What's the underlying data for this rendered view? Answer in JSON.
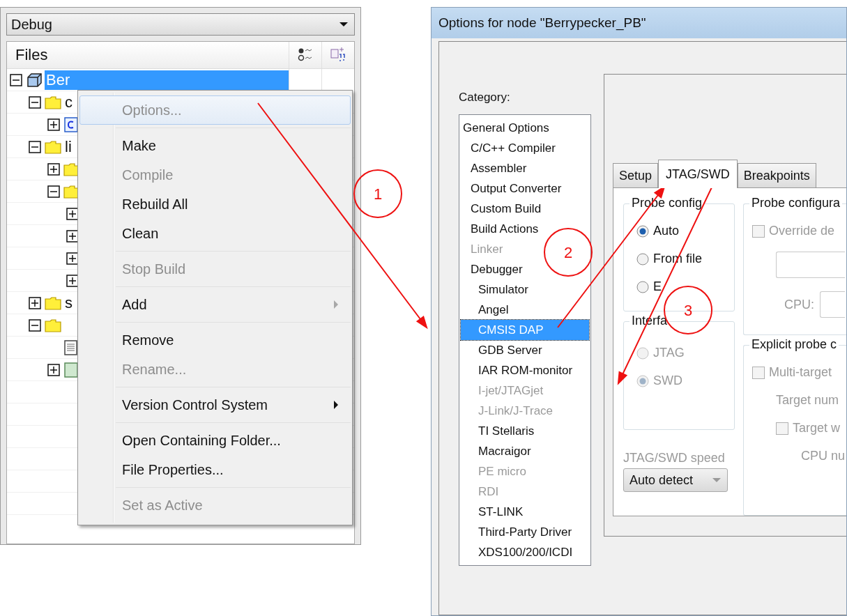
{
  "config_dropdown": {
    "value": "Debug"
  },
  "files_panel": {
    "title": "Files",
    "tree": [
      {
        "label": "Ber",
        "kind": "project",
        "expanded": true,
        "selected": true,
        "children": [
          {
            "label": "c",
            "kind": "folder",
            "expanded": true,
            "selected": false,
            "children": [
              {
                "kind": "cfile",
                "expanded": false
              }
            ]
          },
          {
            "label": "li",
            "kind": "folder",
            "expanded": true,
            "selected": false,
            "children": [
              {
                "kind": "folder",
                "expanded": false
              },
              {
                "kind": "folder",
                "expanded": true,
                "children": [
                  {
                    "expanded": false
                  },
                  {
                    "expanded": false
                  },
                  {
                    "expanded": false
                  },
                  {
                    "expanded": false
                  }
                ]
              }
            ]
          },
          {
            "label": "s",
            "kind": "folder",
            "expanded": false,
            "selected": false
          },
          {
            "kind": "folder",
            "expanded": true,
            "children": [
              {
                "kind": "doc"
              },
              {
                "kind": "output",
                "expanded": false
              }
            ]
          }
        ]
      }
    ]
  },
  "context_menu": {
    "groups": [
      [
        {
          "label": "Options...",
          "disabled": true,
          "highlighted": true,
          "submenu": false
        }
      ],
      [
        {
          "label": "Make",
          "disabled": false,
          "highlighted": false,
          "submenu": false
        },
        {
          "label": "Compile",
          "disabled": true,
          "highlighted": false,
          "submenu": false
        },
        {
          "label": "Rebuild All",
          "disabled": false,
          "highlighted": false,
          "submenu": false
        },
        {
          "label": "Clean",
          "disabled": false,
          "highlighted": false,
          "submenu": false
        }
      ],
      [
        {
          "label": "Stop Build",
          "disabled": true,
          "highlighted": false,
          "submenu": false
        }
      ],
      [
        {
          "label": "Add",
          "disabled": false,
          "highlighted": false,
          "submenu": true,
          "submenu_disabled": true
        }
      ],
      [
        {
          "label": "Remove",
          "disabled": false,
          "highlighted": false,
          "submenu": false
        },
        {
          "label": "Rename...",
          "disabled": true,
          "highlighted": false,
          "submenu": false
        }
      ],
      [
        {
          "label": "Version Control System",
          "disabled": false,
          "highlighted": false,
          "submenu": true,
          "submenu_disabled": false
        }
      ],
      [
        {
          "label": "Open Containing Folder...",
          "disabled": false,
          "highlighted": false,
          "submenu": false
        },
        {
          "label": "File Properties...",
          "disabled": false,
          "highlighted": false,
          "submenu": false
        }
      ],
      [
        {
          "label": "Set as Active",
          "disabled": true,
          "highlighted": false,
          "submenu": false
        }
      ]
    ]
  },
  "dialog": {
    "title": "Options for node \"Berrypecker_PB\"",
    "category_label": "Category:",
    "categories": [
      {
        "label": "General Options",
        "disabled": false,
        "selected": false,
        "children": [
          {
            "label": "C/C++ Compiler",
            "disabled": false,
            "selected": false
          },
          {
            "label": "Assembler",
            "disabled": false,
            "selected": false
          },
          {
            "label": "Output Converter",
            "disabled": false,
            "selected": false
          },
          {
            "label": "Custom Build",
            "disabled": false,
            "selected": false
          },
          {
            "label": "Build Actions",
            "disabled": false,
            "selected": false
          },
          {
            "label": "Linker",
            "disabled": true,
            "selected": false
          },
          {
            "label": "Debugger",
            "disabled": false,
            "selected": false,
            "children": [
              {
                "label": "Simulator",
                "disabled": false,
                "selected": false
              },
              {
                "label": "Angel",
                "disabled": false,
                "selected": false
              },
              {
                "label": "CMSIS DAP",
                "disabled": false,
                "selected": true
              },
              {
                "label": "GDB Server",
                "disabled": false,
                "selected": false
              },
              {
                "label": "IAR ROM-monitor",
                "disabled": false,
                "selected": false
              },
              {
                "label": "I-jet/JTAGjet",
                "disabled": true,
                "selected": false
              },
              {
                "label": "J-Link/J-Trace",
                "disabled": true,
                "selected": false
              },
              {
                "label": "TI Stellaris",
                "disabled": false,
                "selected": false
              },
              {
                "label": "Macraigor",
                "disabled": false,
                "selected": false
              },
              {
                "label": "PE micro",
                "disabled": true,
                "selected": false
              },
              {
                "label": "RDI",
                "disabled": true,
                "selected": false
              },
              {
                "label": "ST-LINK",
                "disabled": false,
                "selected": false
              },
              {
                "label": "Third-Party Driver",
                "disabled": false,
                "selected": false
              },
              {
                "label": "XDS100/200/ICDI",
                "disabled": false,
                "selected": false
              }
            ]
          }
        ]
      }
    ],
    "tabs": [
      {
        "label": "Setup",
        "selected": false
      },
      {
        "label": "JTAG/SWD",
        "selected": true
      },
      {
        "label": "Breakpoints",
        "selected": false
      }
    ],
    "probe_config": {
      "title": "Probe config",
      "disabled": false,
      "options": [
        {
          "label": "Auto",
          "selected": true
        },
        {
          "label": "From file",
          "selected": false
        },
        {
          "label": "E",
          "selected": false
        }
      ]
    },
    "interface": {
      "title": "Interfa",
      "disabled": true,
      "options": [
        {
          "label": "JTAG",
          "selected": false
        },
        {
          "label": "SWD",
          "selected": true
        }
      ]
    },
    "speed": {
      "label": "JTAG/SWD speed",
      "value": "Auto detect",
      "disabled": true
    },
    "probe_configuration": {
      "title": "Probe configura",
      "disabled": true,
      "override": {
        "label": "Override de",
        "checked": false
      },
      "cpu_label": "CPU:"
    },
    "explicit_probe": {
      "title": "Explicit probe c",
      "disabled": true,
      "multi_target": {
        "label": "Multi-target",
        "checked": false
      },
      "target_number_label": "Target num",
      "target_checkbox": {
        "label": "Target w",
        "checked": false
      },
      "cpu_number_label": "CPU nu"
    }
  },
  "annotations": [
    {
      "label": "1"
    },
    {
      "label": "2"
    },
    {
      "label": "3"
    }
  ]
}
